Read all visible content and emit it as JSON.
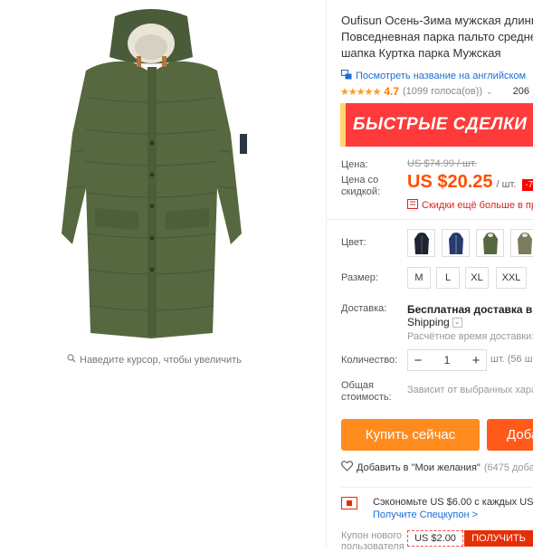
{
  "gallery": {
    "zoom_hint": "Наведите курсор, чтобы увеличить"
  },
  "product": {
    "title_line1": "Oufisun Осень-Зима мужская длинн",
    "title_line2": "Повседневная парка пальто средне",
    "title_line3": "шапка Куртка парка Мужская",
    "translate_link": "Посмотреть название на английском",
    "stars": "★★★★★",
    "rating": "4.7",
    "votes": "(1099 голоса(ов))",
    "orders": "206"
  },
  "banner": {
    "text": "БЫСТРЫЕ СДЕЛКИ",
    "color": "#ff3a3a"
  },
  "price": {
    "label": "Цена:",
    "old": "US $74.99 / шт.",
    "discount_label_1": "Цена со",
    "discount_label_2": "скидкой:",
    "new": "US $20.25",
    "unit": "/ шт.",
    "discount": "-73",
    "coupon_note": "Скидки ещё больше в пр"
  },
  "options": {
    "color_label": "Цвет:",
    "color_swatches": [
      "navy-jacket",
      "blue-jacket",
      "green-jacket",
      "khaki-jacket"
    ],
    "size_label": "Размер:",
    "sizes": [
      "M",
      "L",
      "XL",
      "XXL"
    ]
  },
  "shipping": {
    "label": "Доставка:",
    "title": "Бесплатная доставка в Rus",
    "method": "Shipping",
    "time": "Расчётное время доставки:"
  },
  "quantity": {
    "label": "Количество:",
    "value": "1",
    "minus": "−",
    "plus": "+",
    "available": "шт. (56 ш"
  },
  "total": {
    "label_1": "Общая",
    "label_2": "стоимость:",
    "value": "Зависит от выбранных хара"
  },
  "actions": {
    "buy_now": "Купить сейчас",
    "add_to_cart": "Доба",
    "wishlist": "Добавить в \"Мои желания\"",
    "wishlist_count": "(6475 добав"
  },
  "promo": {
    "save_text": "Сэкономьте US $6.00 с каждых US $6",
    "get_coupon": "Получите Спецкупон >",
    "new_user_label_1": "Купон нового",
    "new_user_label_2": "пользователя",
    "coupon_value": "US $2.00",
    "get_button": "ПОЛУЧИТЬ"
  }
}
